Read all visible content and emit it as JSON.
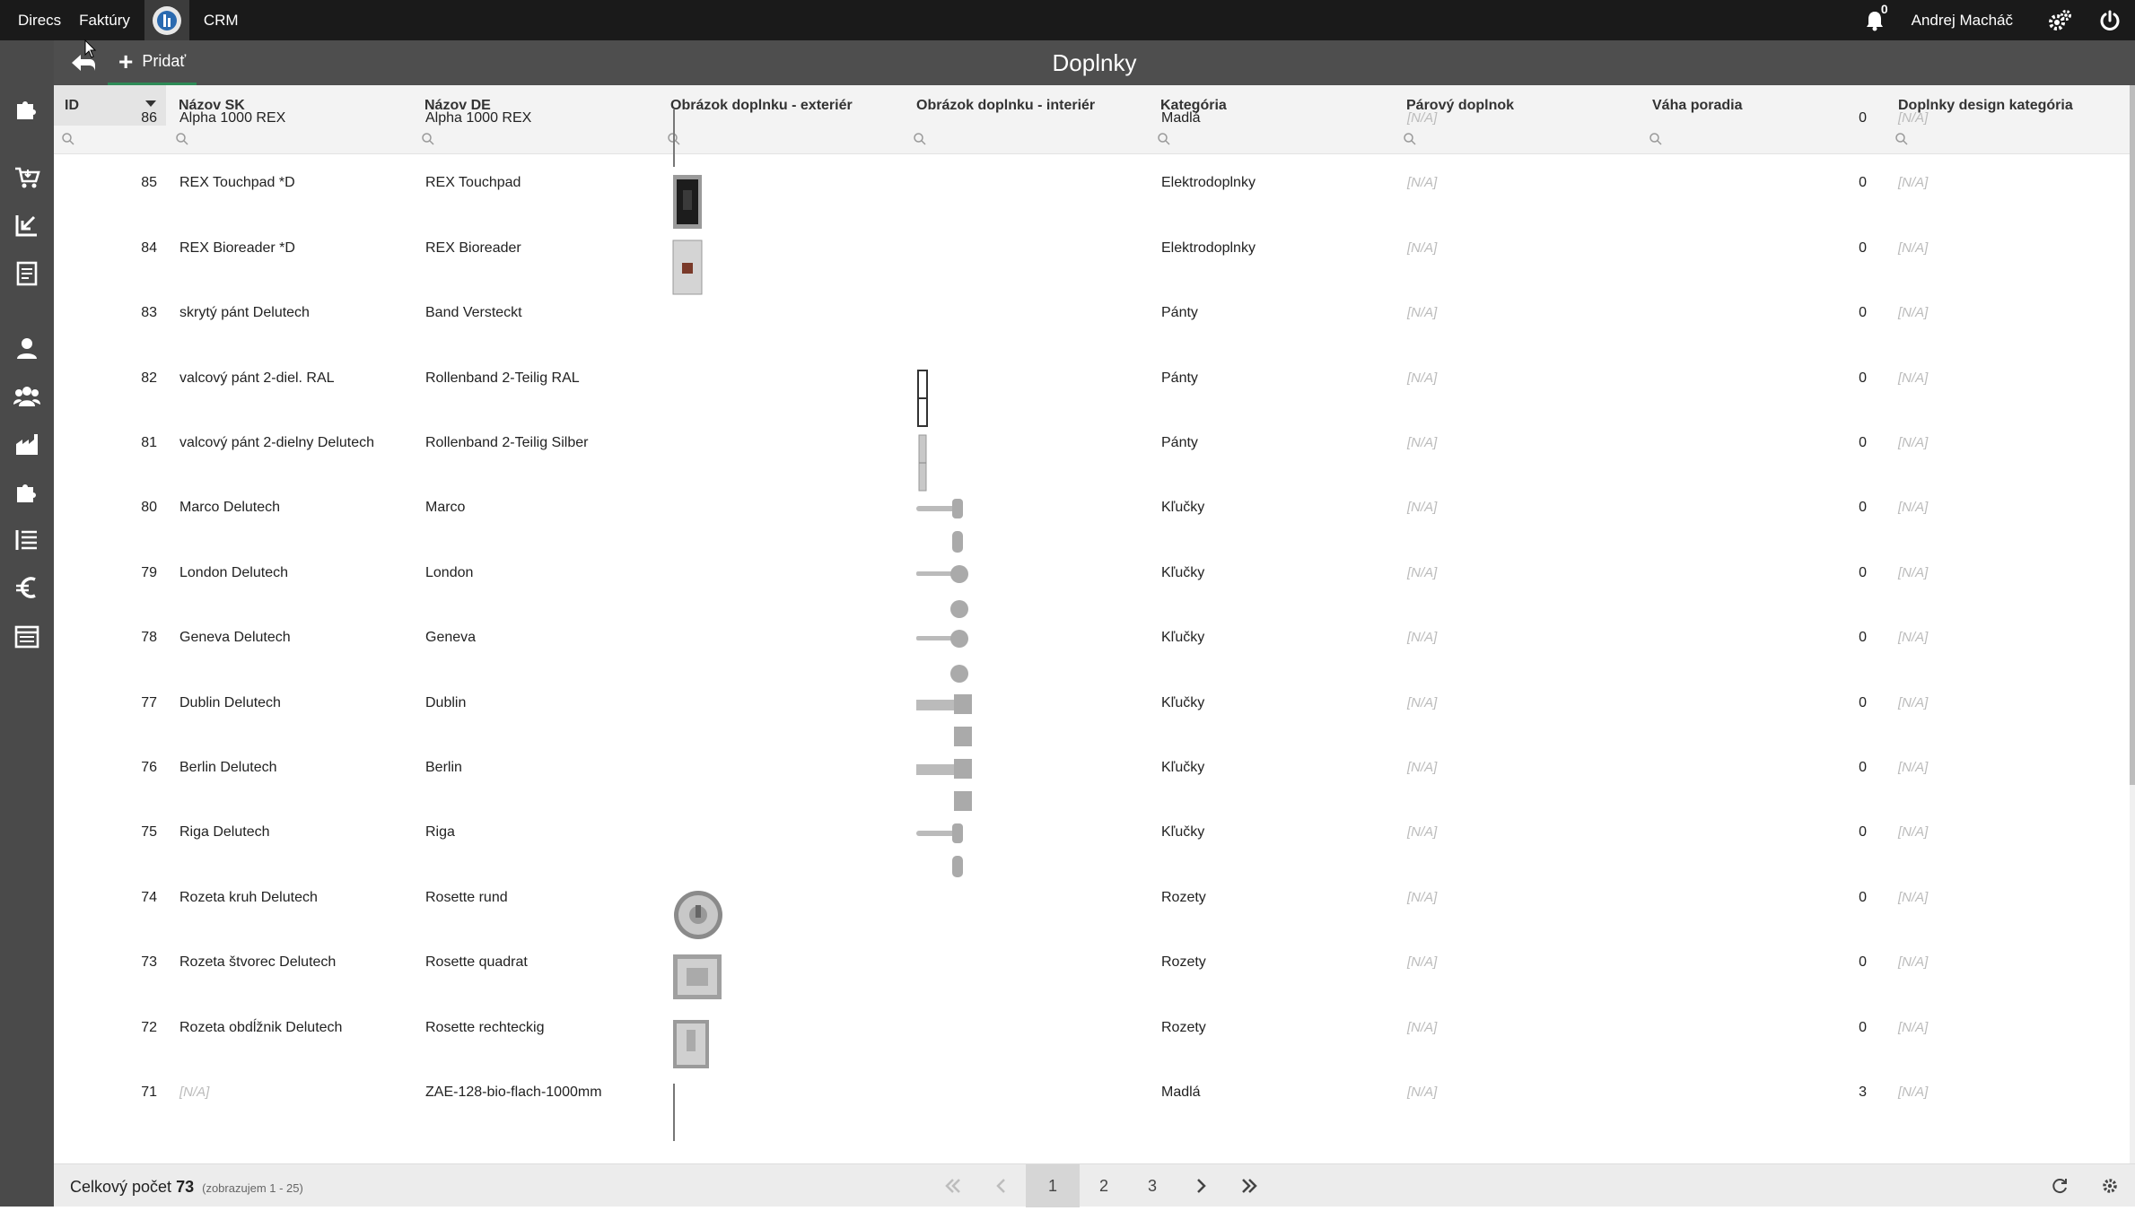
{
  "topbar": {
    "nav": [
      "Direcs",
      "Faktúry",
      "CRM"
    ],
    "notifications_count": "0",
    "user_name": "Andrej Macháč"
  },
  "titlebar": {
    "title": "Doplnky",
    "add_label": "Pridať"
  },
  "grid": {
    "columns": {
      "id": "ID",
      "nazov_sk": "Názov SK",
      "nazov_de": "Názov DE",
      "obr_ext": "Obrázok doplnku - exteriér",
      "obr_int": "Obrázok doplnku - interiér",
      "kategoria": "Kategória",
      "parovy": "Párový doplnok",
      "vaha": "Váha poradia",
      "design_kat": "Doplnky design kategória"
    },
    "rows": [
      {
        "id": "86",
        "sk": "Alpha 1000 REX",
        "de": "Alpha 1000 REX",
        "kat": "Madlá",
        "par": "[N/A]",
        "vaha": "0",
        "dk": "[N/A]",
        "ext": "bar-thin",
        "int": ""
      },
      {
        "id": "85",
        "sk": "REX Touchpad *D",
        "de": "REX Touchpad",
        "kat": "Elektrodoplnky",
        "par": "[N/A]",
        "vaha": "0",
        "dk": "[N/A]",
        "ext": "touchpad",
        "int": ""
      },
      {
        "id": "84",
        "sk": "REX Bioreader *D",
        "de": "REX Bioreader",
        "kat": "Elektrodoplnky",
        "par": "[N/A]",
        "vaha": "0",
        "dk": "[N/A]",
        "ext": "bioreader",
        "int": ""
      },
      {
        "id": "83",
        "sk": "skrytý pánt Delutech",
        "de": "Band Versteckt",
        "kat": "Pánty",
        "par": "[N/A]",
        "vaha": "0",
        "dk": "[N/A]",
        "ext": "",
        "int": ""
      },
      {
        "id": "82",
        "sk": "valcový pánt 2-diel. RAL",
        "de": "Rollenband 2-Teilig RAL",
        "kat": "Pánty",
        "par": "[N/A]",
        "vaha": "0",
        "dk": "[N/A]",
        "ext": "",
        "int": "hinge-ral"
      },
      {
        "id": "81",
        "sk": "valcový pánt 2-dielny Delutech",
        "de": "Rollenband 2-Teilig Silber",
        "kat": "Pánty",
        "par": "[N/A]",
        "vaha": "0",
        "dk": "[N/A]",
        "ext": "",
        "int": "hinge-silver"
      },
      {
        "id": "80",
        "sk": "Marco Delutech",
        "de": "Marco",
        "kat": "Kľučky",
        "par": "[N/A]",
        "vaha": "0",
        "dk": "[N/A]",
        "ext": "",
        "int": "handle-round"
      },
      {
        "id": "79",
        "sk": "London Delutech",
        "de": "London",
        "kat": "Kľučky",
        "par": "[N/A]",
        "vaha": "0",
        "dk": "[N/A]",
        "ext": "",
        "int": "handle-circle"
      },
      {
        "id": "78",
        "sk": "Geneva Delutech",
        "de": "Geneva",
        "kat": "Kľučky",
        "par": "[N/A]",
        "vaha": "0",
        "dk": "[N/A]",
        "ext": "",
        "int": "handle-circle"
      },
      {
        "id": "77",
        "sk": "Dublin Delutech",
        "de": "Dublin",
        "kat": "Kľučky",
        "par": "[N/A]",
        "vaha": "0",
        "dk": "[N/A]",
        "ext": "",
        "int": "handle-square"
      },
      {
        "id": "76",
        "sk": "Berlin Delutech",
        "de": "Berlin",
        "kat": "Kľučky",
        "par": "[N/A]",
        "vaha": "0",
        "dk": "[N/A]",
        "ext": "",
        "int": "handle-square"
      },
      {
        "id": "75",
        "sk": "Riga Delutech",
        "de": "Riga",
        "kat": "Kľučky",
        "par": "[N/A]",
        "vaha": "0",
        "dk": "[N/A]",
        "ext": "",
        "int": "handle-round"
      },
      {
        "id": "74",
        "sk": "Rozeta kruh Delutech",
        "de": "Rosette rund",
        "kat": "Rozety",
        "par": "[N/A]",
        "vaha": "0",
        "dk": "[N/A]",
        "ext": "rosette-round",
        "int": ""
      },
      {
        "id": "73",
        "sk": "Rozeta štvorec Delutech",
        "de": "Rosette quadrat",
        "kat": "Rozety",
        "par": "[N/A]",
        "vaha": "0",
        "dk": "[N/A]",
        "ext": "rosette-square",
        "int": ""
      },
      {
        "id": "72",
        "sk": "Rozeta obdĺžnik Delutech",
        "de": "Rosette rechteckig",
        "kat": "Rozety",
        "par": "[N/A]",
        "vaha": "0",
        "dk": "[N/A]",
        "ext": "rosette-rect",
        "int": ""
      },
      {
        "id": "71",
        "sk": "[N/A]",
        "de": "ZAE-128-bio-flach-1000mm",
        "kat": "Madlá",
        "par": "[N/A]",
        "vaha": "3",
        "dk": "[N/A]",
        "ext": "bar-thin",
        "int": ""
      }
    ]
  },
  "footer": {
    "total_label": "Celkový počet",
    "total_count": "73",
    "showing": "(zobrazujem 1 - 25)",
    "pages": [
      "1",
      "2",
      "3"
    ],
    "current_page": "1"
  },
  "colors": {
    "topbar_bg": "#1a1a1a",
    "sidebar_bg": "#4a4a4a",
    "titlebar_bg": "#4e4e4e",
    "add_underline": "#2e8b57",
    "na_text": "#bbbbbb"
  },
  "icons": {
    "sidebar": [
      "puzzle-icon",
      "cart-icon",
      "chart-down-icon",
      "document-icon",
      "person-icon",
      "group-icon",
      "factory-icon",
      "puzzle-icon",
      "list-icon",
      "euro-icon",
      "table-icon"
    ]
  }
}
